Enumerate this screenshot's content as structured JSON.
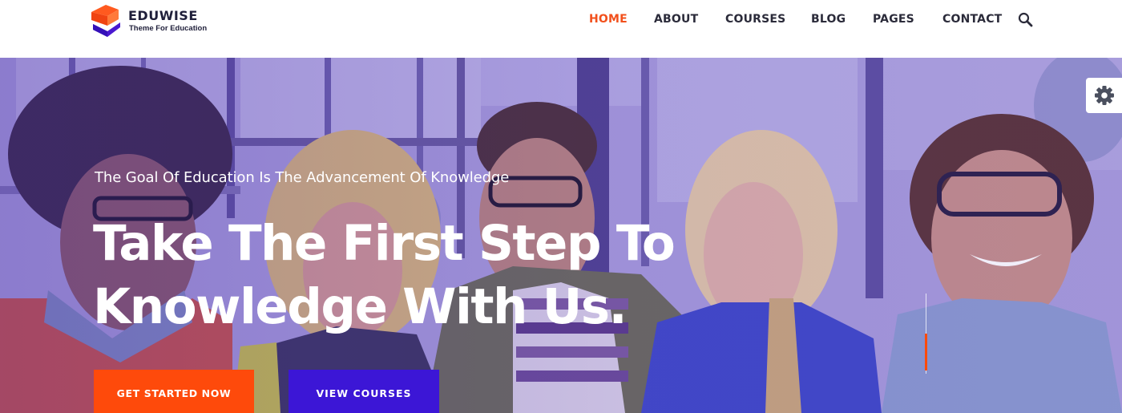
{
  "brand": {
    "name": "EDUWISE",
    "tagline": "Theme For Education"
  },
  "nav": {
    "items": [
      {
        "label": "HOME",
        "active": true
      },
      {
        "label": "ABOUT",
        "active": false
      },
      {
        "label": "COURSES",
        "active": false
      },
      {
        "label": "BLOG",
        "active": false
      },
      {
        "label": "PAGES",
        "active": false
      },
      {
        "label": "CONTACT",
        "active": false
      }
    ],
    "search_icon": "search-icon"
  },
  "hero": {
    "subtitle": "The Goal Of Education Is The Advancement Of Knowledge",
    "title_line1": "Take The First Step To",
    "title_line2": "Knowledge With Us.",
    "primary_button": "GET STARTED NOW",
    "secondary_button": "VIEW COURSES",
    "slide_progress": 0.5
  },
  "settings": {
    "icon": "gear-icon"
  },
  "colors": {
    "accent": "#fe4a0b",
    "secondary": "#3c16d6",
    "nav_active": "#f2501c",
    "text_dark": "#2b2b3a"
  }
}
